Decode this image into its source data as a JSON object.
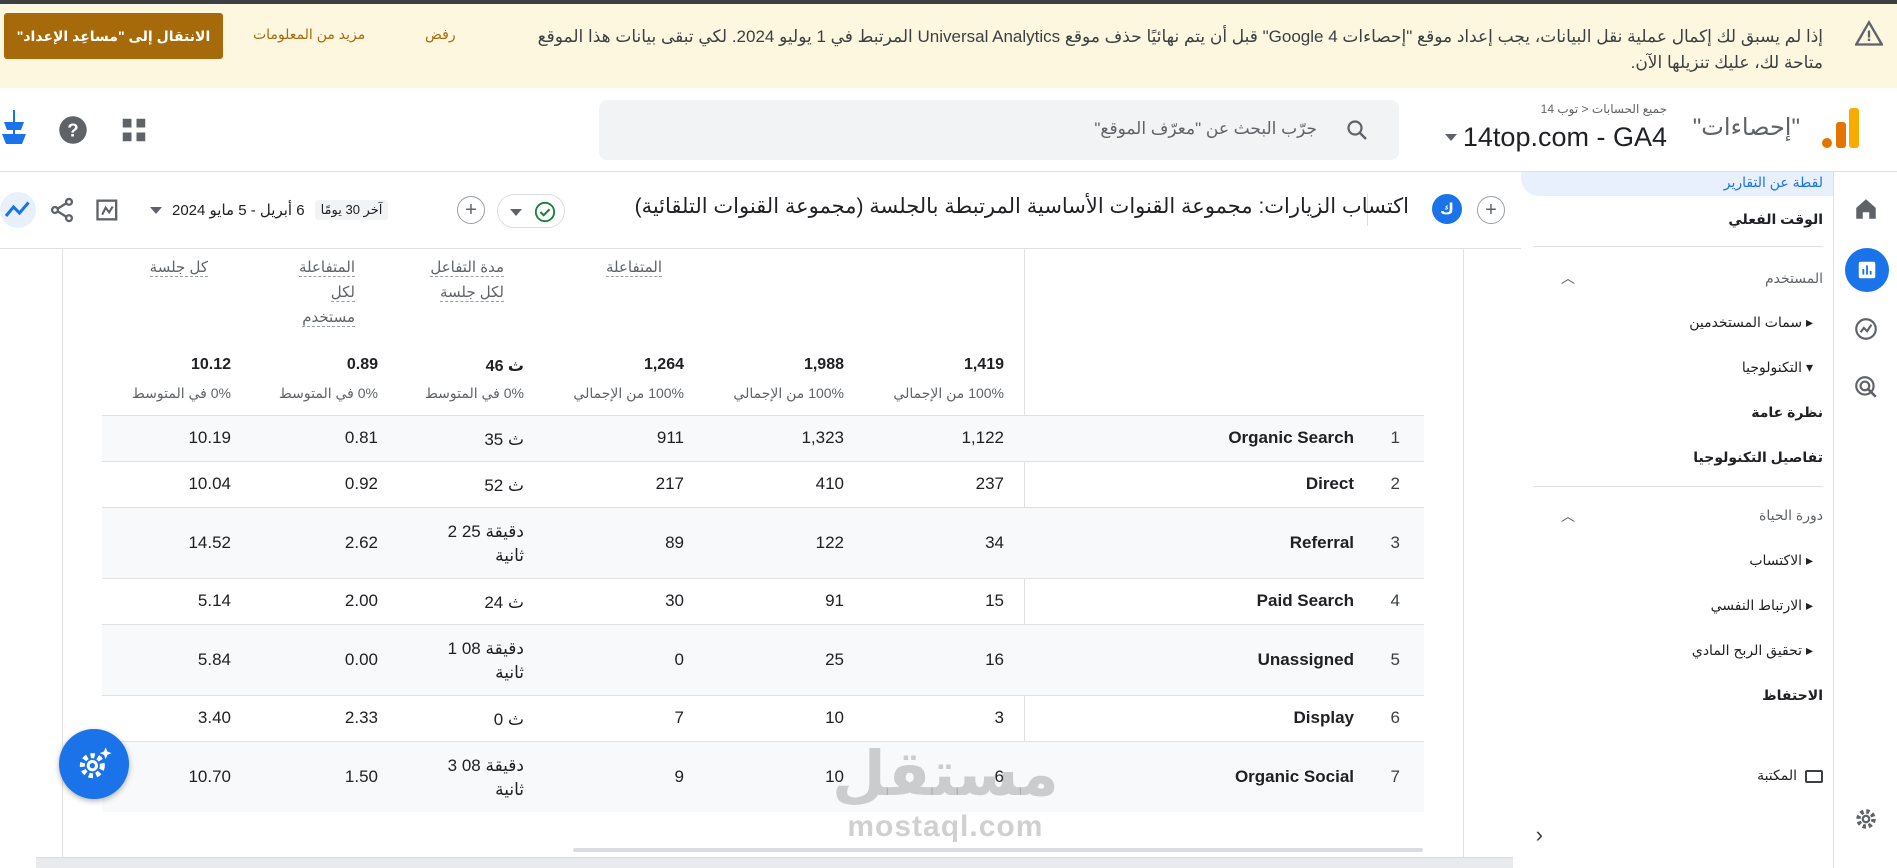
{
  "banner": {
    "message": "إذا لم يسبق لك إكمال عملية نقل البيانات، يجب إعداد موقع \"إحصاءات Google 4\" قبل أن يتم نهائيًا حذف موقع Universal Analytics المرتبط في 1 يوليو 2024. لكي تبقى بيانات هذا الموقع متاحة لك، عليك تنزيلها الآن.",
    "dismiss": "رفض",
    "learn_more": "مزيد من المعلومات",
    "setup_button": "الانتقال إلى \"مساعِد الإعداد\""
  },
  "header": {
    "brand": "\"إحصاءات\"",
    "breadcrumb_all": "جميع الحسابات",
    "breadcrumb_sep": "<",
    "breadcrumb_account": "توب 14",
    "property": "14top.com - GA4",
    "search_placeholder": "جرّب البحث عن \"معرّف الموقع\""
  },
  "menu": {
    "snapshot": "لقطة عن التقارير",
    "realtime": "الوقت الفعلي",
    "user_section": "المستخدم",
    "user_attributes": "سمات المستخدمين",
    "tech": "التكنولوجيا",
    "overview": "نظرة عامة",
    "tech_details": "تفاصيل التكنولوجيا",
    "lifecycle": "دورة الحياة",
    "acquisition": "الاكتساب",
    "engagement": "الارتباط النفسي",
    "monetization": "تحقيق الربح المادي",
    "retention": "الاحتفاظ",
    "library": "المكتبة"
  },
  "toolbar": {
    "avatar_letter": "ك",
    "report_title": "اكتساب الزيارات: مجموعة القنوات الأساسية المرتبطة بالجلسة (مجموعة القنوات التلقائية)",
    "date_label": "آخر 30 يومًا",
    "date_range": "6 أبريل - 5 مايو 2024"
  },
  "table": {
    "headers": {
      "engaged": "المتفاعلة",
      "avg_engagement_1": "مدة التفاعل",
      "avg_engagement_2": "لكل جلسة",
      "engaged_per_user_1": "المتفاعلة",
      "engaged_per_user_2": "لكل",
      "engaged_per_user_3": "مستخدم",
      "events_per_session": "كل جلسة"
    },
    "totals": {
      "users": "1,419",
      "users_sub": "100% من الإجمالي",
      "sessions": "1,988",
      "sessions_sub": "100% من الإجمالي",
      "engaged": "1,264",
      "engaged_sub": "100% من الإجمالي",
      "avg_time": "46 ث",
      "avg_time_sub": "0% في المتوسط",
      "per_user": "0.89",
      "per_user_sub": "0% في المتوسط",
      "per_session": "10.12",
      "per_session_sub": "0% في المتوسط"
    },
    "rows": [
      {
        "idx": "1",
        "channel": "Organic Search",
        "users": "1,122",
        "sessions": "1,323",
        "engaged": "911",
        "avg_time_1": "35 ث",
        "avg_time_2": "",
        "per_user": "0.81",
        "per_session": "10.19"
      },
      {
        "idx": "2",
        "channel": "Direct",
        "users": "237",
        "sessions": "410",
        "engaged": "217",
        "avg_time_1": "52 ث",
        "avg_time_2": "",
        "per_user": "0.92",
        "per_session": "10.04"
      },
      {
        "idx": "3",
        "channel": "Referral",
        "users": "34",
        "sessions": "122",
        "engaged": "89",
        "avg_time_1": "2 دقيقة 25",
        "avg_time_2": "ثانية",
        "per_user": "2.62",
        "per_session": "14.52"
      },
      {
        "idx": "4",
        "channel": "Paid Search",
        "users": "15",
        "sessions": "91",
        "engaged": "30",
        "avg_time_1": "24 ث",
        "avg_time_2": "",
        "per_user": "2.00",
        "per_session": "5.14"
      },
      {
        "idx": "5",
        "channel": "Unassigned",
        "users": "16",
        "sessions": "25",
        "engaged": "0",
        "avg_time_1": "1 دقيقة 08",
        "avg_time_2": "ثانية",
        "per_user": "0.00",
        "per_session": "5.84"
      },
      {
        "idx": "6",
        "channel": "Display",
        "users": "3",
        "sessions": "10",
        "engaged": "7",
        "avg_time_1": "0 ث",
        "avg_time_2": "",
        "per_user": "2.33",
        "per_session": "3.40"
      },
      {
        "idx": "7",
        "channel": "Organic Social",
        "users": "6",
        "sessions": "10",
        "engaged": "9",
        "avg_time_1": "3 دقيقة 08",
        "avg_time_2": "ثانية",
        "per_user": "1.50",
        "per_session": "10.70"
      }
    ]
  },
  "watermark": {
    "arabic": "مستقل",
    "latin": "mostaql.com"
  },
  "colors": {
    "accent": "#1a73e8",
    "banner_bg": "#fef7e0",
    "banner_btn": "#a76a0a",
    "logo": "#f9ab00"
  }
}
